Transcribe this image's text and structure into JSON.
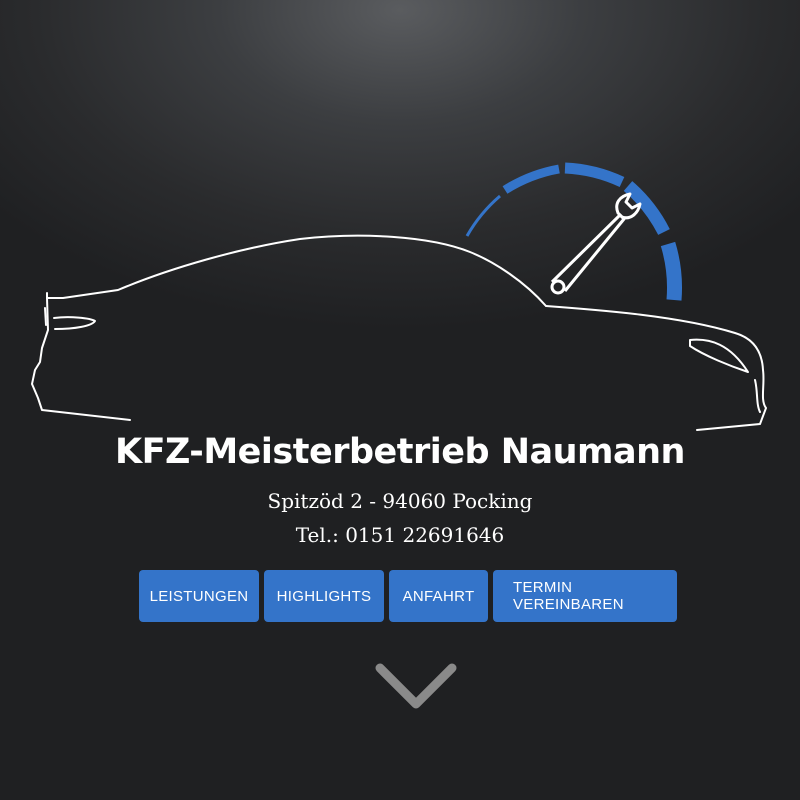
{
  "header": {
    "title": "KFZ-Meisterbetrieb Naumann",
    "address": "Spitzöd 2 - 94060 Pocking",
    "phone": "Tel.: 0151 22691646"
  },
  "nav": {
    "items": [
      {
        "label": "LEISTUNGEN"
      },
      {
        "label": "HIGHLIGHTS"
      },
      {
        "label": "ANFAHRT"
      },
      {
        "label": "TERMIN VEREINBAREN"
      }
    ]
  },
  "icons": {
    "logo": "car-outline-with-wrench-gauge-logo",
    "scroll": "chevron-down-icon"
  },
  "colors": {
    "accent": "#3474c9",
    "background": "#2a2b2d",
    "chevron": "#8a8a8a",
    "text": "#ffffff"
  }
}
